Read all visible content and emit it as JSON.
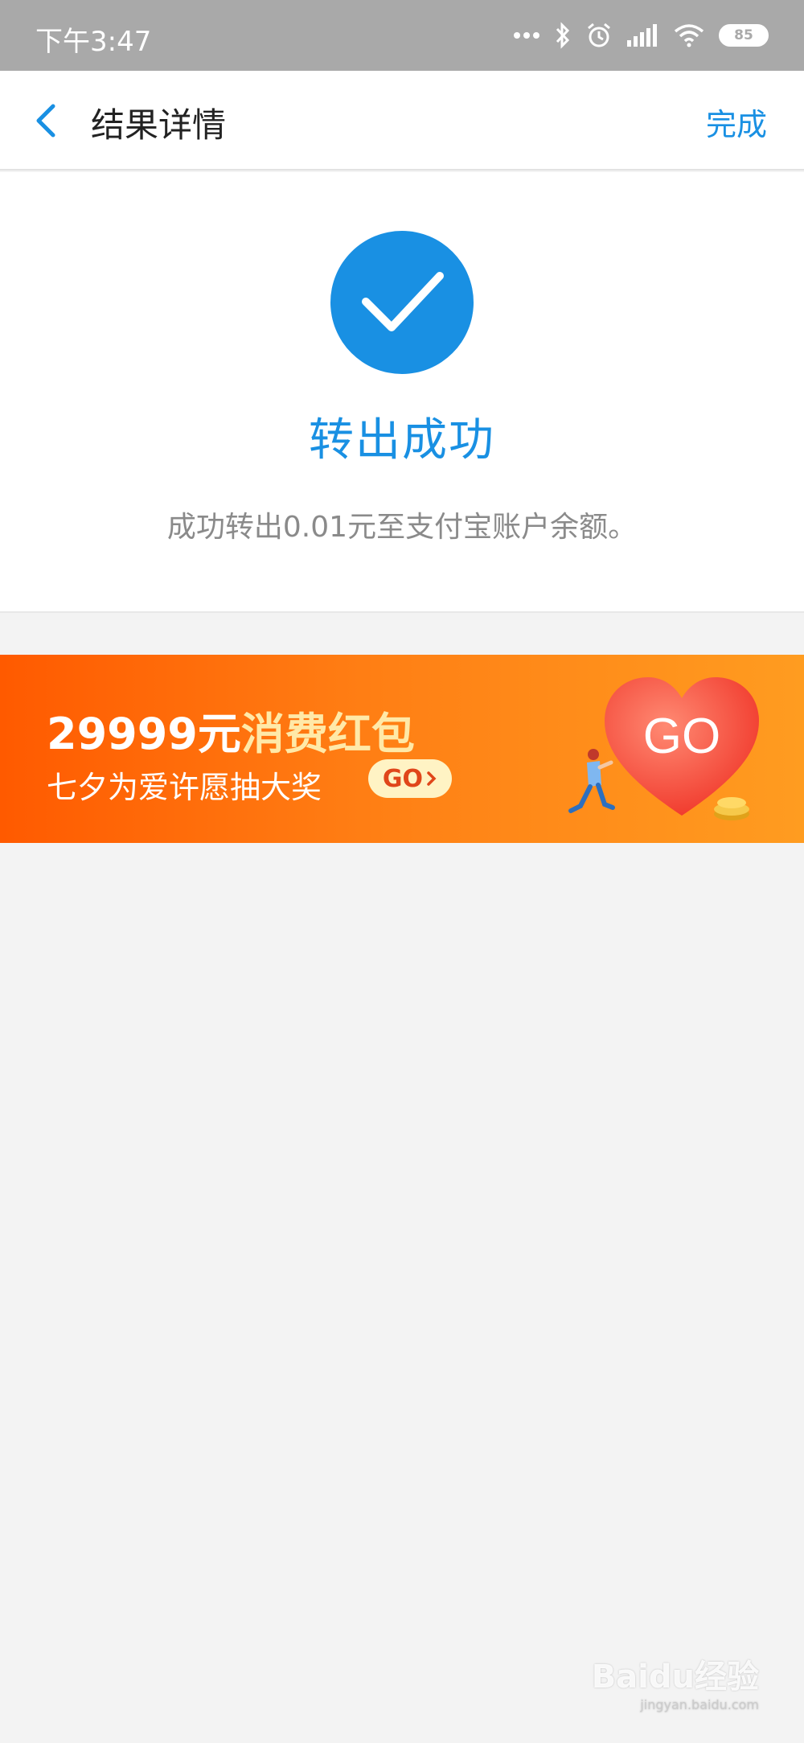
{
  "status_bar": {
    "time": "下午3:47",
    "battery": "85",
    "icons": [
      "more-dots-icon",
      "bluetooth-icon",
      "alarm-icon",
      "signal-icon",
      "wifi-icon",
      "battery-icon"
    ]
  },
  "navbar": {
    "title": "结果详情",
    "done_label": "完成",
    "back_icon": "chevron-left-icon"
  },
  "result": {
    "icon": "check-circle-icon",
    "title": "转出成功",
    "description": "成功转出0.01元至支付宝账户余额。"
  },
  "banner": {
    "title_prefix": "29999元",
    "title_highlight": "消费红包",
    "subtitle": "七夕为爱许愿抽大奖",
    "go_pill_label": "GO",
    "heart_label": "GO"
  },
  "watermark": {
    "text": "Baidu经验",
    "sub": "jingyan.baidu.com"
  },
  "colors": {
    "accent": "#1990e3",
    "status_bar": "#a9a9a9",
    "banner_start": "#ff5a00",
    "banner_end": "#ff9c20"
  }
}
